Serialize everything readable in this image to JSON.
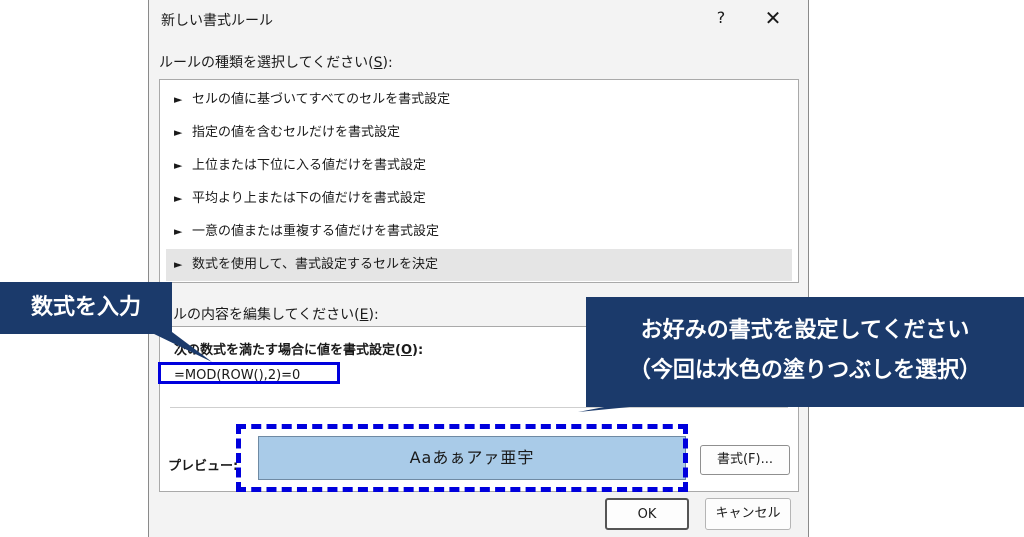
{
  "dialog": {
    "title": "新しい書式ルール",
    "help": "?",
    "close": "✕"
  },
  "rule_type": {
    "label_main": "ルールの種類を選択してください(",
    "label_key": "S",
    "label_end": "):",
    "items": [
      "セルの値に基づいてすべてのセルを書式設定",
      "指定の値を含むセルだけを書式設定",
      "上位または下位に入る値だけを書式設定",
      "平均より上または下の値だけを書式設定",
      "一意の値または重複する値だけを書式設定",
      "数式を使用して、書式設定するセルを決定"
    ],
    "selected_index": 5
  },
  "edit": {
    "label_main": "ルの内容を編集してください(",
    "label_key": "E",
    "label_end": "):",
    "subhead_main": "次の数式を満たす場合に値を書式設定(",
    "subhead_key": "O",
    "subhead_end": "):",
    "formula": "=MOD(ROW(),2)=0",
    "preview_label": "プレビュー:",
    "preview_text": "Aaあぁアァ亜宇",
    "format_button": "書式(F)..."
  },
  "buttons": {
    "ok": "OK",
    "cancel": "キャンセル"
  },
  "annotations": {
    "left": "数式を入力",
    "right_line1": "お好みの書式を設定してください",
    "right_line2": "（今回は水色の塗りつぶしを選択）"
  },
  "colors": {
    "annotation_bg": "#1b3a6b",
    "highlight": "#0000dd",
    "preview_fill": "#a9cbe8"
  }
}
